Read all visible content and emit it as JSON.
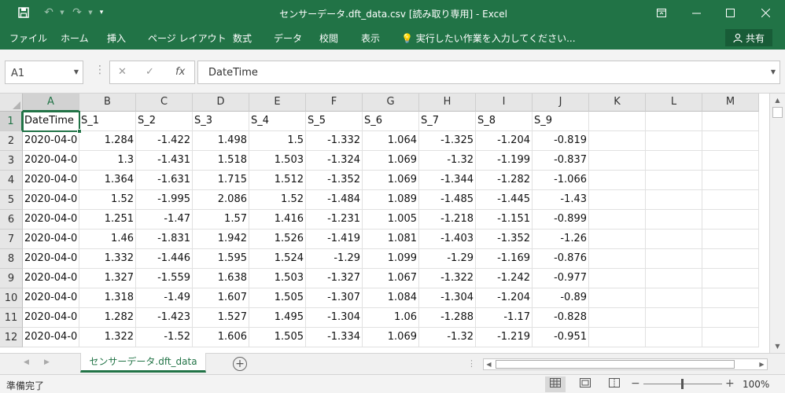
{
  "window": {
    "title": "センサーデータ.dft_data.csv  [読み取り専用] - Excel",
    "minimize_icon": "minimize-icon",
    "maximize_icon": "maximize-icon",
    "close_icon": "close-icon",
    "restore_ribbon_icon": "ribbon-display-icon"
  },
  "quick_access": {
    "save_icon": "save-icon",
    "undo_icon": "undo-icon",
    "redo_icon": "redo-icon",
    "customize_icon": "chevron-down-icon"
  },
  "ribbon": {
    "tabs": [
      "ファイル",
      "ホーム",
      "挿入",
      "ページ レイアウト",
      "数式",
      "データ",
      "校閲",
      "表示"
    ],
    "tell_me": "実行したい作業を入力してください...",
    "share_label": "共有"
  },
  "formula_bar": {
    "name_box": "A1",
    "formula": "DateTime"
  },
  "columns": [
    "A",
    "B",
    "C",
    "D",
    "E",
    "F",
    "G",
    "H",
    "I",
    "J",
    "K",
    "L",
    "M"
  ],
  "rows": [
    "1",
    "2",
    "3",
    "4",
    "5",
    "6",
    "7",
    "8",
    "9",
    "10",
    "11",
    "12"
  ],
  "cells": [
    [
      "DateTime",
      "S_1",
      "S_2",
      "S_3",
      "S_4",
      "S_5",
      "S_6",
      "S_7",
      "S_8",
      "S_9"
    ],
    [
      "2020-04-0",
      "1.284",
      "-1.422",
      "1.498",
      "1.5",
      "-1.332",
      "1.064",
      "-1.325",
      "-1.204",
      "-0.819"
    ],
    [
      "2020-04-0",
      "1.3",
      "-1.431",
      "1.518",
      "1.503",
      "-1.324",
      "1.069",
      "-1.32",
      "-1.199",
      "-0.837"
    ],
    [
      "2020-04-0",
      "1.364",
      "-1.631",
      "1.715",
      "1.512",
      "-1.352",
      "1.069",
      "-1.344",
      "-1.282",
      "-1.066"
    ],
    [
      "2020-04-0",
      "1.52",
      "-1.995",
      "2.086",
      "1.52",
      "-1.484",
      "1.089",
      "-1.485",
      "-1.445",
      "-1.43"
    ],
    [
      "2020-04-0",
      "1.251",
      "-1.47",
      "1.57",
      "1.416",
      "-1.231",
      "1.005",
      "-1.218",
      "-1.151",
      "-0.899"
    ],
    [
      "2020-04-0",
      "1.46",
      "-1.831",
      "1.942",
      "1.526",
      "-1.419",
      "1.081",
      "-1.403",
      "-1.352",
      "-1.26"
    ],
    [
      "2020-04-0",
      "1.332",
      "-1.446",
      "1.595",
      "1.524",
      "-1.29",
      "1.099",
      "-1.29",
      "-1.169",
      "-0.876"
    ],
    [
      "2020-04-0",
      "1.327",
      "-1.559",
      "1.638",
      "1.503",
      "-1.327",
      "1.067",
      "-1.322",
      "-1.242",
      "-0.977"
    ],
    [
      "2020-04-0",
      "1.318",
      "-1.49",
      "1.607",
      "1.505",
      "-1.307",
      "1.084",
      "-1.304",
      "-1.204",
      "-0.89"
    ],
    [
      "2020-04-0",
      "1.282",
      "-1.423",
      "1.527",
      "1.495",
      "-1.304",
      "1.06",
      "-1.288",
      "-1.17",
      "-0.828"
    ],
    [
      "2020-04-0",
      "1.322",
      "-1.52",
      "1.606",
      "1.505",
      "-1.334",
      "1.069",
      "-1.32",
      "-1.219",
      "-0.951"
    ]
  ],
  "sheet_tabs": [
    "センサーデータ.dft_data"
  ],
  "status": {
    "text": "準備完了",
    "zoom": "100%"
  },
  "colors": {
    "accent": "#217346"
  }
}
